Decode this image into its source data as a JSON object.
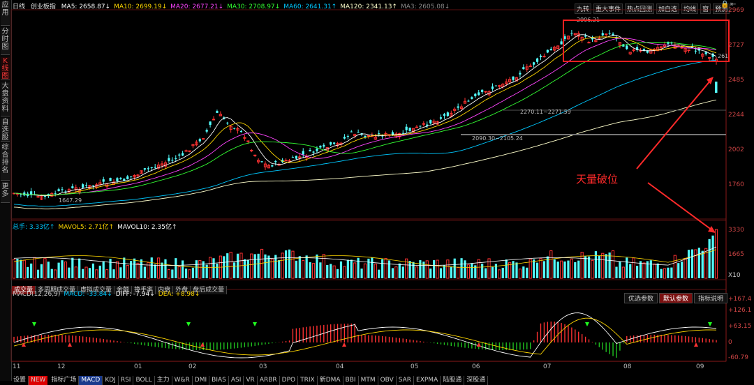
{
  "sidebar": {
    "tabs": [
      "应用",
      "分时图",
      "K线图",
      "大盘资料",
      "自选股",
      "综合排名",
      "更多"
    ]
  },
  "header": {
    "period": "日线",
    "name": "创业板指",
    "ma": [
      {
        "label": "MA5: 2658.87↓",
        "color": "#ffffff"
      },
      {
        "label": "MA10: 2699.19↓",
        "color": "#ffd700"
      },
      {
        "label": "MA20: 2677.21↓",
        "color": "#ff44ff"
      },
      {
        "label": "MA30: 2708.97↓",
        "color": "#33ff33"
      },
      {
        "label": "MA60: 2641.31↑",
        "color": "#00c8ff"
      },
      {
        "label": "MA120: 2341.13↑",
        "color": "#ffffcc"
      },
      {
        "label": "MA3: 2605.08↓",
        "color": "#888888"
      }
    ],
    "buttons": [
      "九转",
      "重大事件",
      "热点回测",
      "加自选",
      "均线",
      "窗",
      "预测"
    ]
  },
  "price_scale": [
    "2969",
    "2727",
    "2485",
    "2244",
    "2002",
    "1760"
  ],
  "price_annotations": {
    "high": "2906.21",
    "low": "1647.29",
    "box1": "2270.11~2271.59",
    "box2": "2090.30~2105.24",
    "last": "261"
  },
  "annotation": {
    "text": "天量破位",
    "color": "#ff2a2a"
  },
  "volume": {
    "header": [
      {
        "label": "总手: 3.33亿↑",
        "color": "#00c8ff"
      },
      {
        "label": "MAVOL5: 2.71亿↑",
        "color": "#ffd700"
      },
      {
        "label": "MAVOL10: 2.35亿↑",
        "color": "#ffffff"
      }
    ],
    "scale": [
      "3330",
      "1665",
      "X10"
    ],
    "tabs": [
      "成交量",
      "多周期成交量",
      "虚拟成交量",
      "金额",
      "换手率",
      "内盘",
      "外盘",
      "盘后成交量"
    ]
  },
  "macd": {
    "header": [
      {
        "label": "MACD(12,26,9)",
        "color": "#ccc"
      },
      {
        "label": "MACD: -33.84↓",
        "color": "#00c8ff"
      },
      {
        "label": "DIFF: -7.94↓",
        "color": "#ffffff"
      },
      {
        "label": "DEA: +8.98↓",
        "color": "#ffd700"
      }
    ],
    "buttons": [
      "优选参数",
      "默认参数",
      "指标说明"
    ],
    "scale": [
      "+167.4",
      "+126.1",
      "+63.15",
      "0",
      "-60.79"
    ]
  },
  "dates": [
    "11",
    "12",
    "01",
    "02",
    "03",
    "04",
    "05",
    "06",
    "07",
    "08",
    "09"
  ],
  "bottom_tabs": {
    "settings": "设置",
    "new_badge": "NEW",
    "items": [
      "指标广场",
      "MACD",
      "KDJ",
      "RSI",
      "BOLL",
      "主力",
      "W&R",
      "DMI",
      "BIAS",
      "ASI",
      "VR",
      "ARBR",
      "DPO",
      "TRIX",
      "新DMA",
      "BBI",
      "MTM",
      "OBV",
      "SAR",
      "EXPMA",
      "陆股通",
      "深股通"
    ]
  },
  "colors": {
    "up": "#ff3232",
    "down": "#54ffff",
    "box": "#ff2020"
  }
}
